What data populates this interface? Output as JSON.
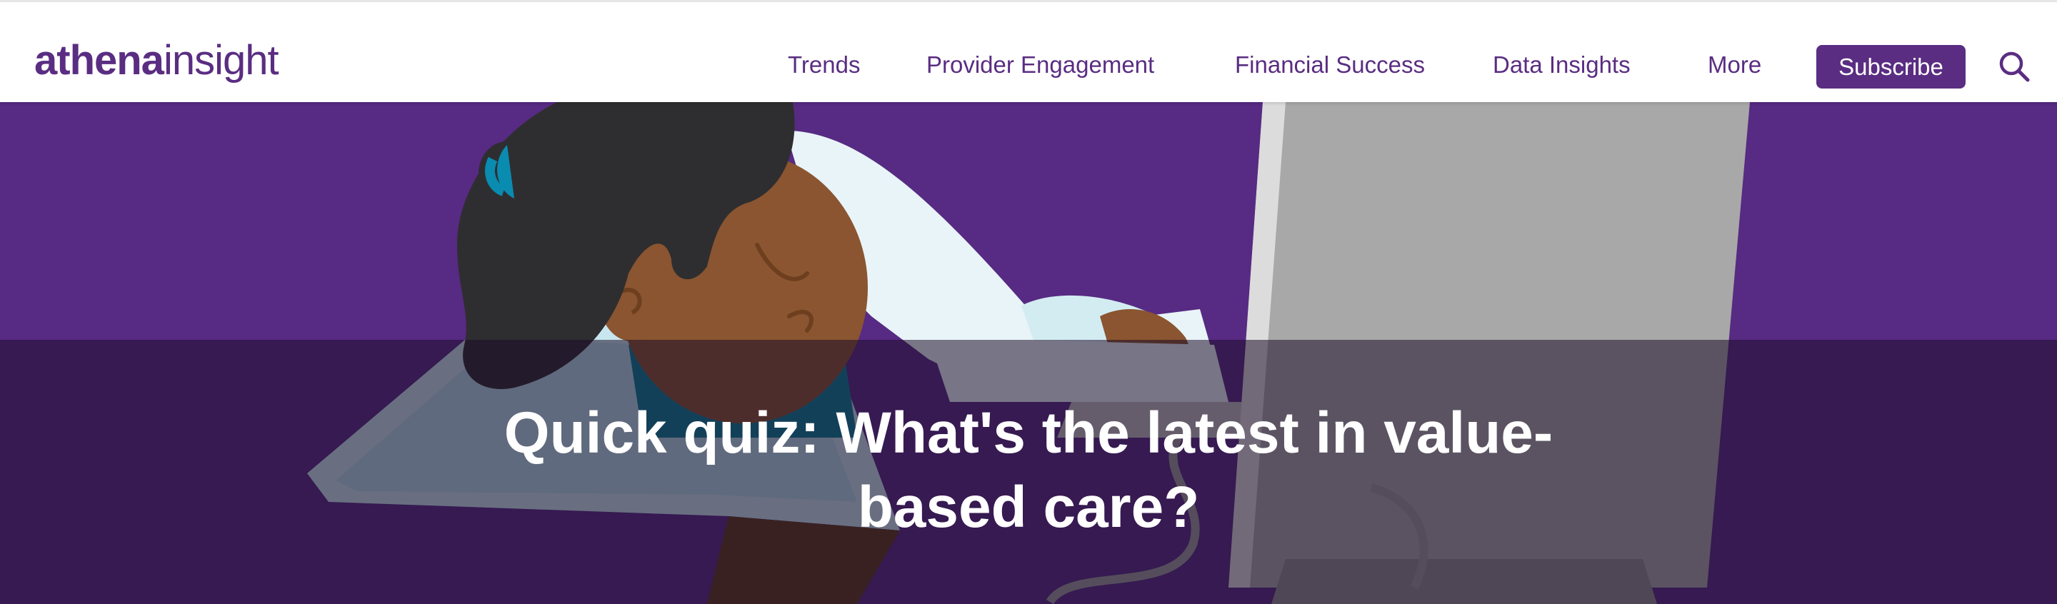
{
  "brand": {
    "logo_bold": "athena",
    "logo_light": "insight",
    "primary_color": "#5a2d82"
  },
  "nav": {
    "items": [
      {
        "label": "Trends"
      },
      {
        "label": "Provider Engagement"
      },
      {
        "label": "Financial Success"
      },
      {
        "label": "Data Insights"
      },
      {
        "label": "More"
      }
    ],
    "subscribe_label": "Subscribe",
    "search_icon": "search-icon"
  },
  "hero": {
    "title": "Quick quiz: What's the latest in value-based care?",
    "background_color": "#572a83",
    "illustration": "doctor-sleeping-at-desk-illustration"
  }
}
